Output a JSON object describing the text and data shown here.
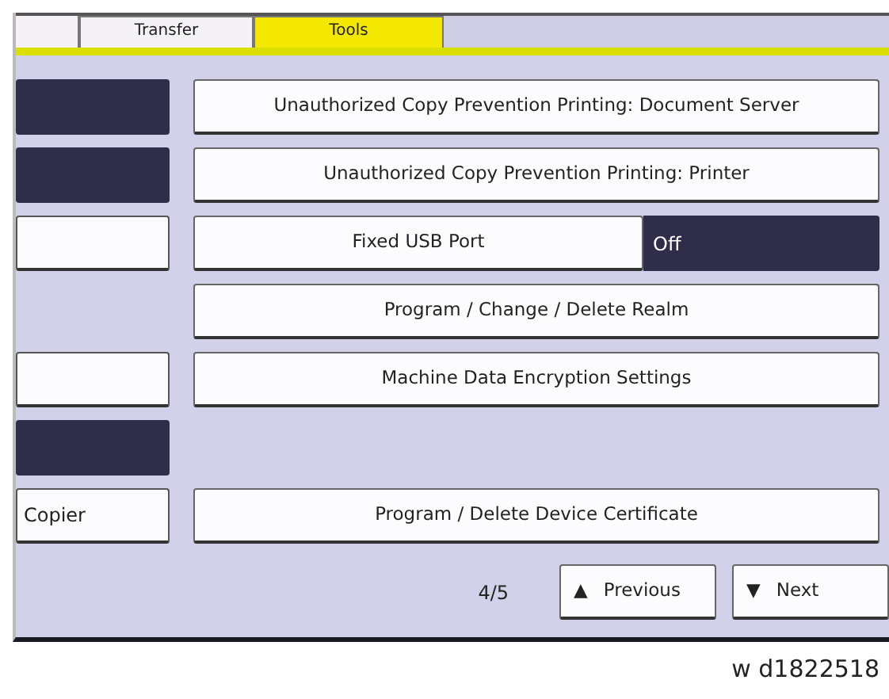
{
  "tabs": [
    {
      "label": "Transfer",
      "selected": false
    },
    {
      "label": "Tools",
      "selected": true
    }
  ],
  "rows": [
    {
      "left": {
        "selected": true
      },
      "right": {
        "kind": "button",
        "label": "Unauthorized Copy Prevention Printing: Document Server"
      }
    },
    {
      "left": {
        "selected": true
      },
      "right": {
        "kind": "button",
        "label": "Unauthorized Copy Prevention Printing: Printer"
      }
    },
    {
      "left": {
        "selected": false
      },
      "right": {
        "kind": "setting",
        "label": "Fixed USB Port",
        "value": "Off"
      }
    },
    {
      "right": {
        "kind": "button",
        "label": "Program / Change / Delete Realm"
      }
    },
    {
      "left": {
        "selected": false
      },
      "right": {
        "kind": "button",
        "label": "Machine Data Encryption Settings"
      }
    },
    {
      "left": {
        "selected": true
      }
    },
    {
      "left": {
        "selected": false,
        "label": "Copier"
      },
      "right": {
        "kind": "button",
        "label": "Program / Delete Device Certificate"
      }
    }
  ],
  "pager": {
    "page": "4/5",
    "previous": {
      "arrow": "▲",
      "label": "Previous"
    },
    "next": {
      "arrow": "▼",
      "label": "Next"
    }
  },
  "caption": "w d1822518"
}
